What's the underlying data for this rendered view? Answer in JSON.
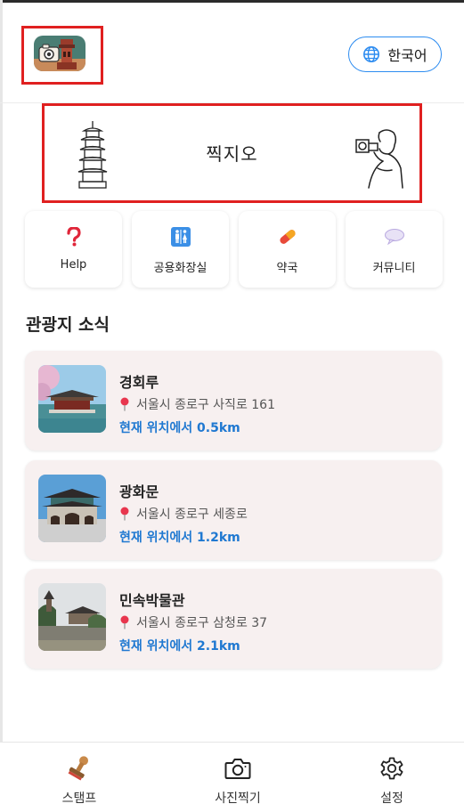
{
  "header": {
    "language_button": "한국어"
  },
  "banner": {
    "title": "찍지오"
  },
  "quick_menu": [
    {
      "label": "Help",
      "icon": "question-icon"
    },
    {
      "label": "공용화장실",
      "icon": "restroom-icon"
    },
    {
      "label": "약국",
      "icon": "pill-icon"
    },
    {
      "label": "커뮤니티",
      "icon": "speech-bubble-icon"
    }
  ],
  "section": {
    "title": "관광지 소식"
  },
  "places": [
    {
      "name": "경회루",
      "address": "서울시 종로구 사직로 161",
      "distance": "현재 위치에서 0.5km"
    },
    {
      "name": "광화문",
      "address": "서울시 종로구 세종로",
      "distance": "현재 위치에서 1.2km"
    },
    {
      "name": "민속박물관",
      "address": "서울시 종로구 삼청로 37",
      "distance": "현재 위치에서 2.1km"
    }
  ],
  "bottom_nav": [
    {
      "label": "스탬프",
      "icon": "stamp-icon"
    },
    {
      "label": "사진찍기",
      "icon": "camera-icon"
    },
    {
      "label": "설정",
      "icon": "gear-icon"
    }
  ],
  "colors": {
    "accent": "#2d8cf0",
    "distance_text": "#1f78d1",
    "highlight_frame": "#e02020",
    "card_bg": "#f7f0f0"
  }
}
